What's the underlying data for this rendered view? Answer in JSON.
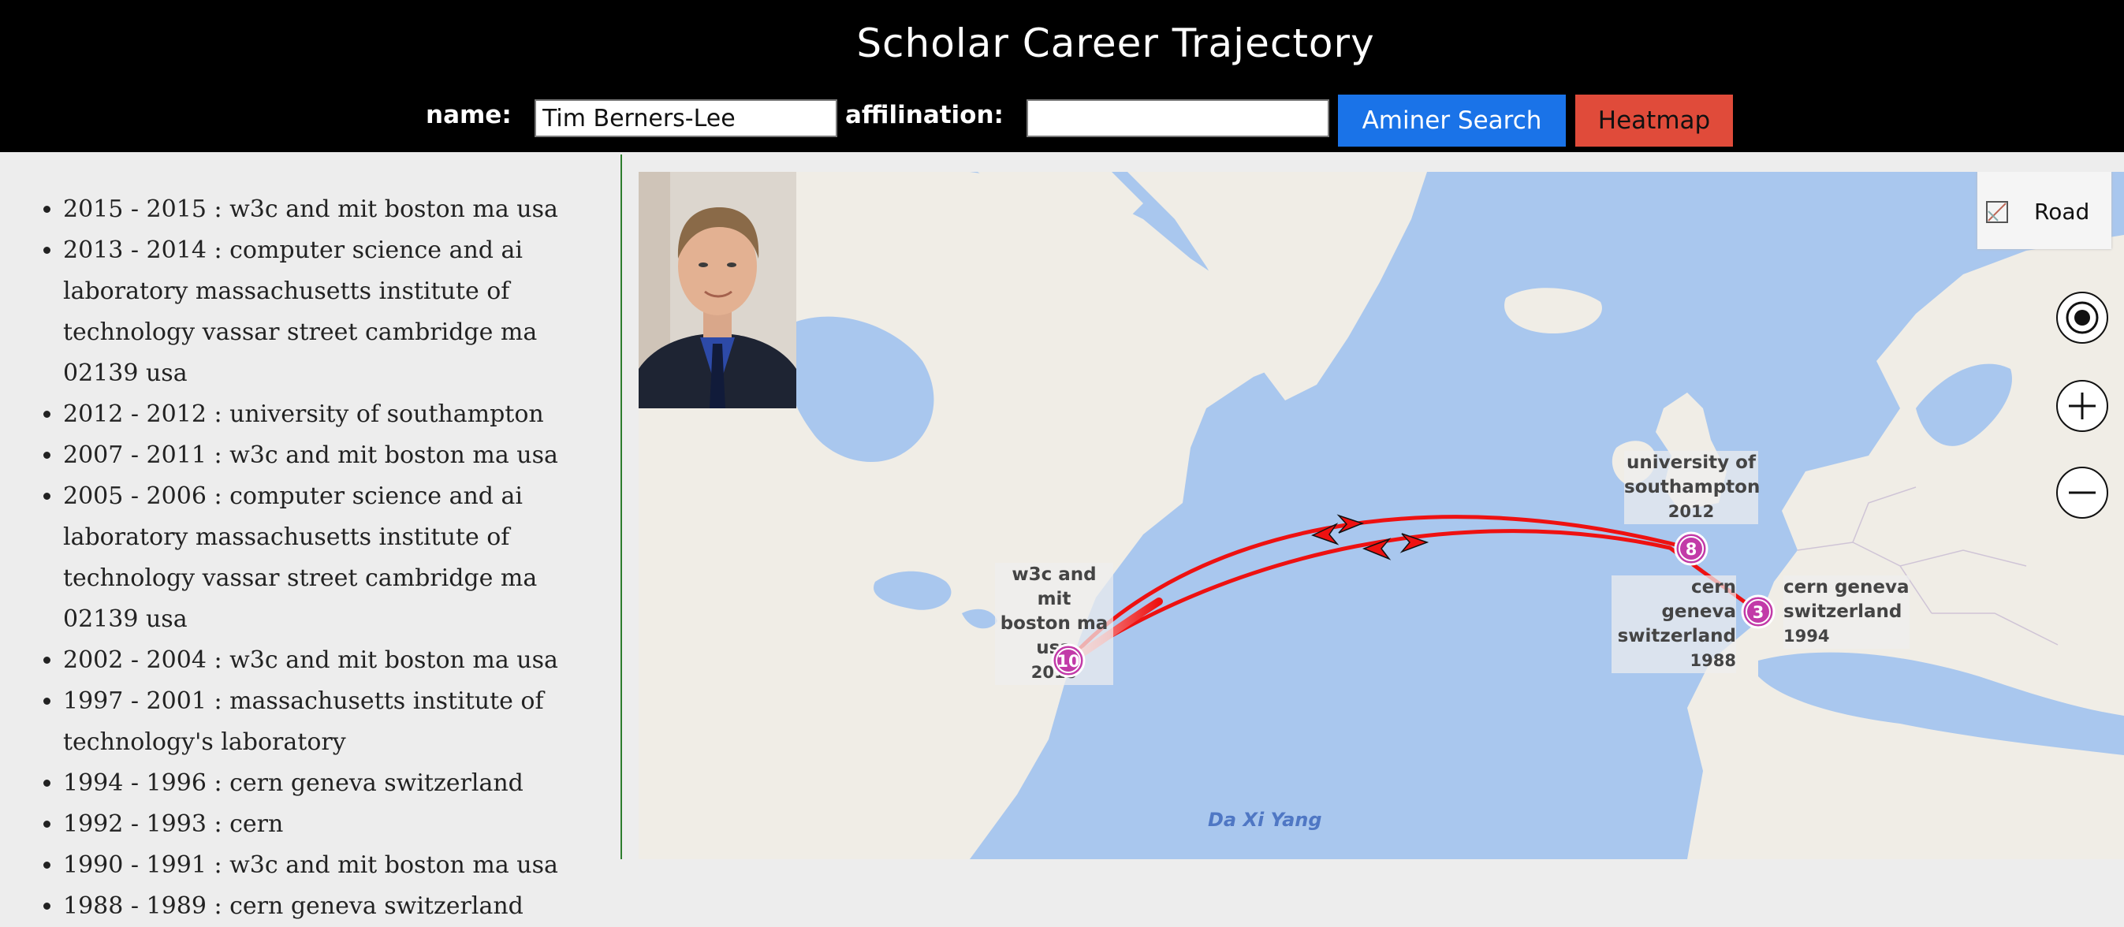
{
  "header": {
    "title": "Scholar Career Trajectory",
    "name_label": "name:",
    "name_value": "Tim Berners-Lee",
    "affiliation_label": "affilination:",
    "affiliation_value": "",
    "search_button": "Aminer Search",
    "heatmap_button": "Heatmap"
  },
  "history": [
    "2015 - 2015 : w3c and mit boston ma usa",
    "2013 - 2014 : computer science and ai laboratory massachusetts institute of technology vassar street cambridge ma 02139 usa",
    "2012 - 2012 : university of southampton",
    "2007 - 2011 : w3c and mit boston ma usa",
    "2005 - 2006 : computer science and ai laboratory massachusetts institute of technology vassar street cambridge ma 02139 usa",
    "2002 - 2004 : w3c and mit boston ma usa",
    "1997 - 2001 : massachusetts institute of technology's laboratory",
    "1994 - 1996 : cern geneva switzerland",
    "1992 - 1993 : cern",
    "1990 - 1991 : w3c and mit boston ma usa",
    "1988 - 1989 : cern geneva switzerland"
  ],
  "map": {
    "style_label": "Road",
    "ocean_label": "Da Xi Yang",
    "colors": {
      "water": "#a9c7ee",
      "land": "#f0ede6",
      "route": "#ee1111",
      "pin": "#c23aa8"
    },
    "pins": [
      {
        "count": "10",
        "lines": [
          "w3c and mit",
          "boston ma usa"
        ],
        "year": "2015"
      },
      {
        "count": "8",
        "lines": [
          "university of",
          "southampton"
        ],
        "year": "2012"
      },
      {
        "count": "3",
        "lines_left": [
          "cern geneva",
          "switzerland"
        ],
        "year_left": "1988",
        "lines_right": [
          "cern geneva",
          "switzerland"
        ],
        "year_right": "1994"
      }
    ]
  },
  "colors": {
    "search_button": "#1a73e8",
    "heatmap_button": "#e04b3a"
  }
}
